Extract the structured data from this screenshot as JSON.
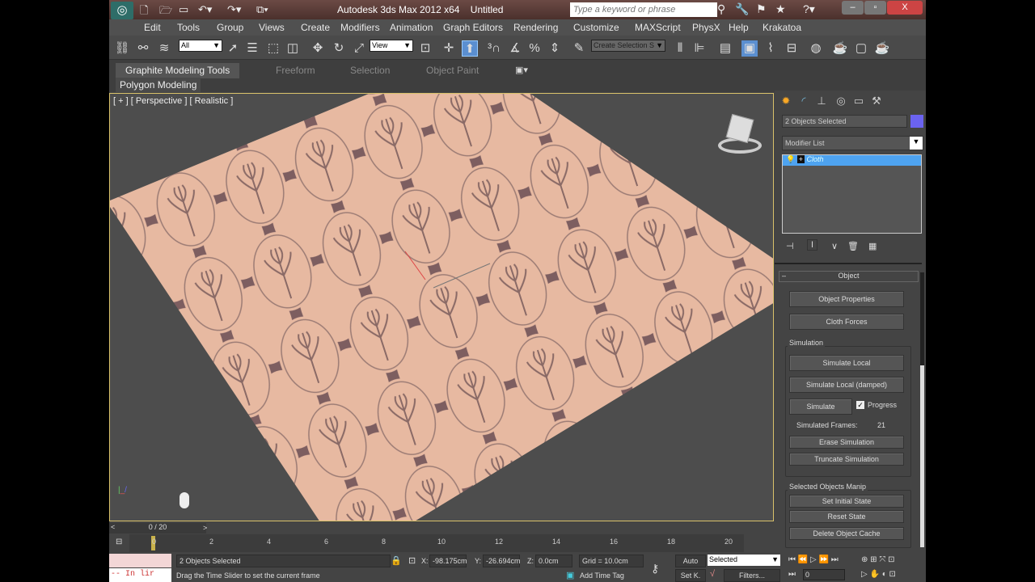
{
  "titlebar": {
    "app_title": "Autodesk 3ds Max  2012 x64",
    "doc_title": "Untitled",
    "search_placeholder": "Type a keyword or phrase"
  },
  "menu": [
    "Edit",
    "Tools",
    "Group",
    "Views",
    "Create",
    "Modifiers",
    "Animation",
    "Graph Editors",
    "Rendering",
    "Customize",
    "MAXScript",
    "PhysX",
    "Help",
    "Krakatoa"
  ],
  "toolbar": {
    "selection_filter": "All",
    "ref_coord": "View",
    "named_selection": "Create Selection S"
  },
  "ribbon": {
    "tabs": [
      "Graphite Modeling Tools",
      "Freeform",
      "Selection",
      "Object Paint"
    ],
    "panel": "Polygon Modeling"
  },
  "viewport": {
    "label": "[ + ] [ Perspective ] [ Realistic ]"
  },
  "command_panel": {
    "object_name": "2 Objects Selected",
    "object_color": "#6b63f0",
    "modifier_list": "Modifier List",
    "stack": [
      {
        "name": "Cloth"
      }
    ],
    "rollout_title": "Object",
    "object_properties": "Object Properties",
    "cloth_forces": "Cloth Forces",
    "simulation_group": "Simulation",
    "simulate_local": "Simulate Local",
    "simulate_local_damped": "Simulate Local (damped)",
    "simulate": "Simulate",
    "progress_label": "Progress",
    "progress_checked": true,
    "simulated_frames_label": "Simulated Frames:",
    "simulated_frames": "21",
    "erase_simulation": "Erase Simulation",
    "truncate_simulation": "Truncate Simulation",
    "manip_group": "Selected Objects Manip",
    "set_initial_state": "Set Initial State",
    "reset_state": "Reset State",
    "delete_object_cache": "Delete Object Cache"
  },
  "timeline": {
    "slider": "0 / 20",
    "ticks": [
      "0",
      "2",
      "4",
      "6",
      "8",
      "10",
      "12",
      "14",
      "16",
      "18",
      "20"
    ]
  },
  "status": {
    "selection": "2 Objects Selected",
    "prompt": "Drag the Time Slider to set the current frame",
    "x": "-98.175cm",
    "y": "-26.694cm",
    "z": "0.0cm",
    "x_label": "X:",
    "y_label": "Y:",
    "z_label": "Z:",
    "grid": "Grid = 10.0cm",
    "add_time_tag": "Add Time Tag",
    "auto": "Auto",
    "setk": "Set K.",
    "key_filter": "Selected",
    "filters": "Filters...",
    "frame": "0",
    "listener": "-- In lir"
  }
}
